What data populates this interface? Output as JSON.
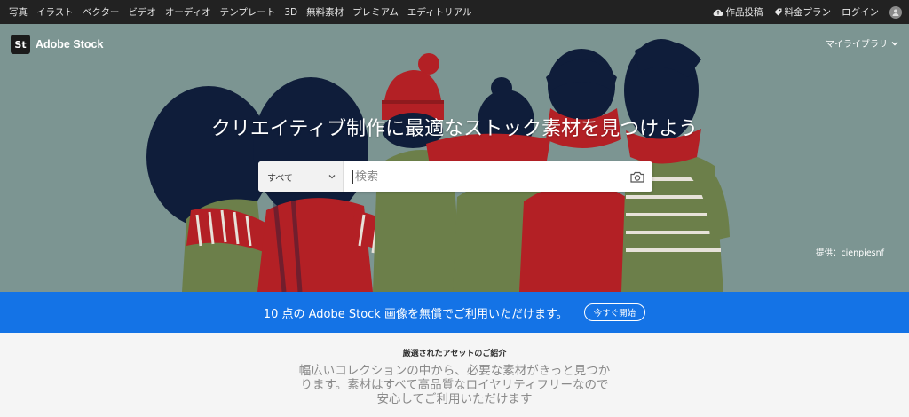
{
  "topnav": {
    "left_items": [
      "写真",
      "イラスト",
      "ベクター",
      "ビデオ",
      "オーディオ",
      "テンプレート",
      "3D",
      "無料素材",
      "プレミアム",
      "エディトリアル"
    ],
    "upload_label": "作品投稿",
    "pricing_label": "料金プラン",
    "login_label": "ログイン"
  },
  "logo": {
    "mark": "St",
    "name": "Adobe Stock"
  },
  "mylibrary": "マイライブラリ",
  "hero": {
    "headline": "クリエイティブ制作に最適なストック素材を見つけよう",
    "credit": "提供：cienpiesnf"
  },
  "search": {
    "category": "すべて",
    "placeholder": "検索"
  },
  "promo": {
    "text": "10 点の Adobe Stock 画像を無償でご利用いただけます。",
    "button": "今すぐ開始"
  },
  "section": {
    "kicker": "厳選されたアセットのご紹介",
    "description": "幅広いコレクションの中から、必要な素材がきっと見つかります。素材はすべて高品質なロイヤリティフリーなので安心してご利用いただけます"
  },
  "colors": {
    "topnav_bg": "#222222",
    "hero_bg": "#7c9592",
    "promo_bg": "#1473e6",
    "navy": "#0f1d3a",
    "red": "#b32025",
    "olive": "#6c7f4a"
  }
}
